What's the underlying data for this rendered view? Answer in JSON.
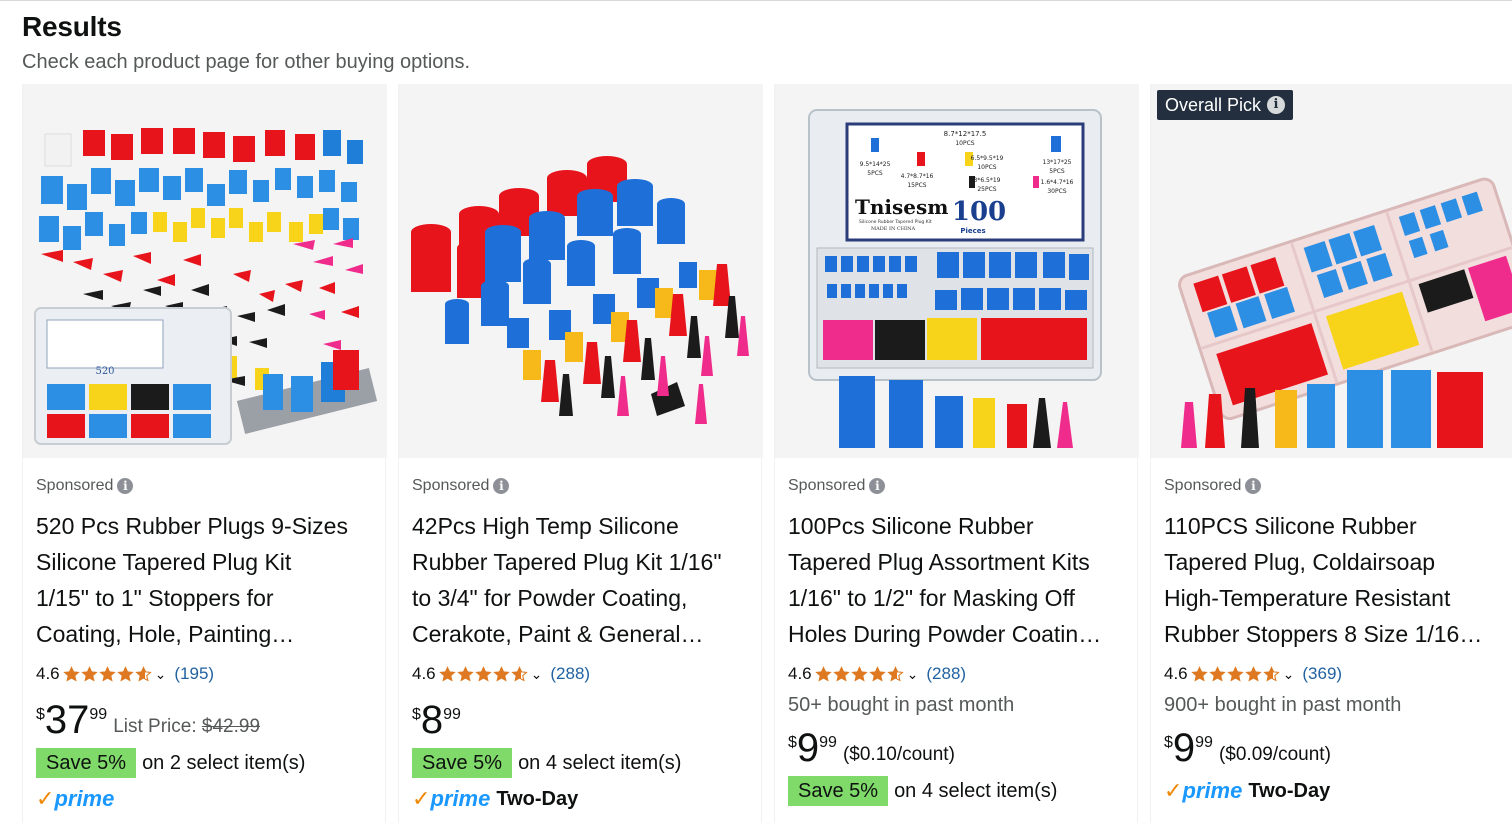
{
  "header": {
    "title": "Results",
    "subtitle": "Check each product page for other buying options."
  },
  "products": [
    {
      "badge": "",
      "sponsored": "Sponsored",
      "title_lines": [
        "520 Pcs Rubber Plugs 9-Sizes",
        "Silicone Tapered Plug Kit",
        "1/15\" to 1\" Stoppers for",
        "Coating, Hole, Painting…"
      ],
      "rating": "4.6",
      "rating_value": 4.6,
      "review_count": "(195)",
      "bought": "",
      "price_symbol": "$",
      "price_whole": "37",
      "price_fraction": "99",
      "after_price_label": "List Price: ",
      "after_price_value": "$42.99",
      "save_badge": "Save 5%",
      "save_text": "on 2 select item(s)",
      "prime_word": "prime",
      "prime_extra": ""
    },
    {
      "badge": "",
      "sponsored": "Sponsored",
      "title_lines": [
        "42Pcs High Temp Silicone",
        "Rubber Tapered Plug Kit 1/16\"",
        "to 3/4\" for Powder Coating,",
        "Cerakote, Paint & General…"
      ],
      "rating": "4.6",
      "rating_value": 4.6,
      "review_count": "(288)",
      "bought": "",
      "price_symbol": "$",
      "price_whole": "8",
      "price_fraction": "99",
      "after_price_label": "",
      "after_price_value": "",
      "save_badge": "Save 5%",
      "save_text": "on 4 select item(s)",
      "prime_word": "prime",
      "prime_extra": "Two-Day"
    },
    {
      "badge": "",
      "sponsored": "Sponsored",
      "title_lines": [
        "100Pcs Silicone Rubber",
        "Tapered Plug Assortment Kits",
        "1/16\" to 1/2\" for Masking Off",
        "Holes During Powder Coatin…"
      ],
      "rating": "4.6",
      "rating_value": 4.6,
      "review_count": "(288)",
      "bought": "50+ bought in past month",
      "price_symbol": "$",
      "price_whole": "9",
      "price_fraction": "99",
      "after_price_label": "($0.10/count)",
      "after_price_value": "",
      "save_badge": "Save 5%",
      "save_text": "on 4 select item(s)",
      "prime_word": "",
      "prime_extra": "",
      "image_text": {
        "brand": "Tnisesm",
        "count": "100",
        "pieces": "Pieces",
        "product_line": "Silicone Rubber Tapered Plug Kit",
        "made_in": "MADE IN CHINA",
        "sizes": [
          {
            "dim": "8.7*12*17.5",
            "qty": "10PCS"
          },
          {
            "dim": "9.5*14*25",
            "qty": "5PCS"
          },
          {
            "dim": "6.5*9.5*19",
            "qty": "10PCS"
          },
          {
            "dim": "13*17*25",
            "qty": "5PCS"
          },
          {
            "dim": "4.7*8.7*16",
            "qty": "15PCS"
          },
          {
            "dim": "3*6.5*19",
            "qty": "25PCS"
          },
          {
            "dim": "1.6*4.7*16",
            "qty": "30PCS"
          }
        ]
      }
    },
    {
      "badge": "Overall Pick",
      "sponsored": "Sponsored",
      "title_lines": [
        "110PCS Silicone Rubber",
        "Tapered Plug, Coldairsoap",
        "High-Temperature Resistant",
        "Rubber Stoppers 8 Size 1/16…"
      ],
      "rating": "4.6",
      "rating_value": 4.6,
      "review_count": "(369)",
      "bought": "900+ bought in past month",
      "price_symbol": "$",
      "price_whole": "9",
      "price_fraction": "99",
      "after_price_label": "($0.09/count)",
      "after_price_value": "",
      "save_badge": "",
      "save_text": "",
      "prime_word": "prime",
      "prime_extra": "Two-Day"
    }
  ],
  "colors": {
    "star": "#de7921",
    "link": "#2162a1",
    "save_green": "#7fda69",
    "prime_blue": "#1a98ff",
    "prime_check": "#f08804",
    "badge_bg": "#232f3e"
  },
  "icons": {
    "info": "info-icon",
    "star": "star-icon",
    "chevron": "chevron-down-icon",
    "prime_check": "prime-check-icon"
  }
}
